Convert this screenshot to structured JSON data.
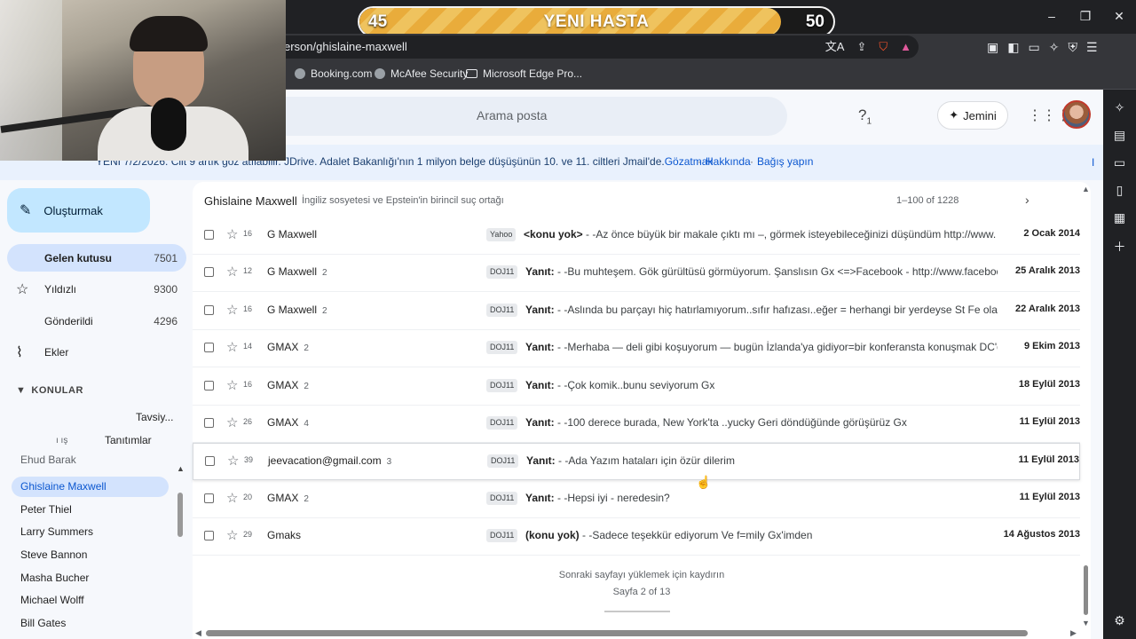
{
  "progress": {
    "left_value": "45",
    "title": "YENI HASTA",
    "right_value": "50",
    "fraction": 0.89
  },
  "browser": {
    "url": "erson/ghislaine-maxwell",
    "bookmarks": [
      {
        "label": "Booking.com"
      },
      {
        "label": "McAfee Security"
      },
      {
        "label": "Microsoft Edge Pro..."
      }
    ],
    "window_controls": [
      "–",
      "❐",
      "✕"
    ]
  },
  "header": {
    "search_placeholder": "Arama posta",
    "help_glyph": "?⁾",
    "jemini_label": "Jemini",
    "help_badge": "1"
  },
  "banner": {
    "text": "YENI 7/2/2026: Cilt 9 artık göz atılabilir. JDrive. Adalet Bakanlığı'nın 1 milyon belge düşüşünün 10. ve 11. ciltleri Jmail'de.",
    "link_go": "Gözatmak",
    "link_about": "Hakkında",
    "link_donate": "Bağış yapın",
    "sep": "·",
    "right_mark": "I"
  },
  "sidebar": {
    "compose_label": "Oluşturmak",
    "items": [
      {
        "label": "Gelen kutusu",
        "count": "7501"
      },
      {
        "label": "Yıldızlı",
        "count": "9300"
      },
      {
        "label": "Gönderildi",
        "count": "4296"
      },
      {
        "label": "Ekler",
        "count": ""
      }
    ],
    "section_title": "KONULAR",
    "sub_items": [
      "Tavsiy...",
      "Tanıtımlar"
    ],
    "sub_icon_text": "ı  ış",
    "labels": [
      "Ehud Barak",
      "Ghislaine Maxwell",
      "Peter Thiel",
      "Larry Summers",
      "Steve Bannon",
      "Masha Bucher",
      "Michael Wolff",
      "Bill Gates"
    ]
  },
  "list": {
    "title": "Ghislaine Maxwell",
    "subtitle": "İngiliz sosyetesi ve Epstein'in birincil suç ortağı",
    "pager": "1–100 of 1228",
    "rows": [
      {
        "imp": "16",
        "sender": "G Maxwell",
        "count": "",
        "tag": "Yahoo",
        "subject": "<konu yok>",
        "snippet": " - -Az önce büyük bir makale çıktı mı –, görmek isteyebileceğinizi düşündüm http://www.orig",
        "date": "2 Ocak 2014"
      },
      {
        "imp": "12",
        "sender": "G Maxwell",
        "count": "2",
        "tag": "DOJ11",
        "subject": "Yanıt:",
        "snippet": " - -Bu muhteşem. Gök gürültüsü görmüyorum. Şanslısın Gx <=>Facebook - http://www.faceboo",
        "date": "25 Aralık 2013"
      },
      {
        "imp": "16",
        "sender": "G Maxwell",
        "count": "2",
        "tag": "DOJ11",
        "subject": "Yanıt:",
        "snippet": " - -Aslında bu parçayı hiç hatırlamıyorum..sıfır hafızası..eğer = herhangi bir yerdeyse St Fe olabil",
        "date": "22 Aralık 2013"
      },
      {
        "imp": "14",
        "sender": "GMAX",
        "count": "2",
        "tag": "DOJ11",
        "subject": "Yanıt:",
        "snippet": " - -Merhaba — deli gibi koşuyorum — bugün İzlanda'ya gidiyor=bir konferansta konuşmak DC'deyd",
        "date": "9 Ekim 2013"
      },
      {
        "imp": "16",
        "sender": "GMAX",
        "count": "2",
        "tag": "DOJ11",
        "subject": "Yanıt:",
        "snippet": " - -Çok komik..bunu seviyorum Gx",
        "date": "18 Eylül 2013"
      },
      {
        "imp": "26",
        "sender": "GMAX",
        "count": "4",
        "tag": "DOJ11",
        "subject": "Yanıt:",
        "snippet": " - -100 derece burada, New York'ta ..yucky Geri döndüğünde görüşürüz Gx",
        "date": "11 Eylül 2013"
      },
      {
        "imp": "39",
        "sender": "jeevacation@gmail.com",
        "count": "3",
        "tag": "DOJ11",
        "subject": "Yanıt:",
        "snippet": " - -Ada Yazım hataları için özür dilerim",
        "date": "11 Eylül 2013"
      },
      {
        "imp": "20",
        "sender": "GMAX",
        "count": "2",
        "tag": "DOJ11",
        "subject": "Yanıt:",
        "snippet": " - -Hepsi iyi - neredesin?",
        "date": "11 Eylül 2013"
      },
      {
        "imp": "29",
        "sender": "Gmaks",
        "count": "",
        "tag": "DOJ11",
        "subject": "(konu yok)",
        "snippet": " - -Sadece teşekkür ediyorum Ve f=mily Gx'imden",
        "date": "14 Ağustos 2013"
      }
    ],
    "scroll_hint": "Sonraki sayfayı yüklemek için kaydırın",
    "page_info": "Sayfa 2 of 13"
  },
  "colors": {
    "accent": "#0b57d0",
    "compose": "#c2e7ff",
    "active_nav": "#d3e3fd",
    "progress": "#e9ac3b"
  },
  "icons": [
    "pencil-icon",
    "star-icon",
    "send-icon",
    "paperclip-icon",
    "inbox-icon",
    "chevron-right-icon",
    "gear-icon",
    "apps-icon",
    "help-icon",
    "sparkle-icon"
  ]
}
